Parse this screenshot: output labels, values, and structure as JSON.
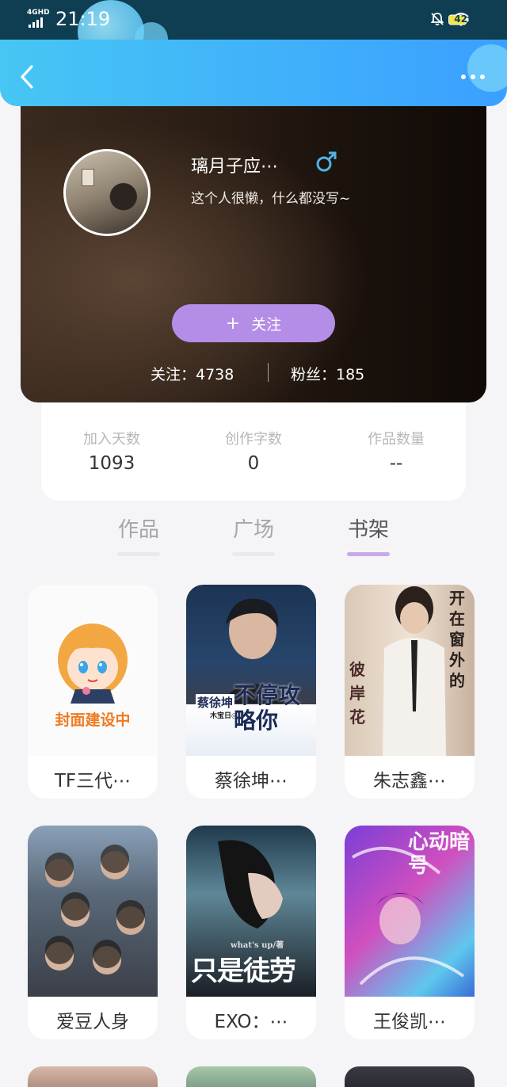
{
  "status_bar": {
    "network": "4GHD",
    "time": "21:19",
    "battery": "42"
  },
  "header": {
    "back_icon": "chevron-left-icon",
    "more_icon": "more-dots-icon"
  },
  "profile": {
    "name": "璃月子应⋯",
    "gender_icon": "male-icon",
    "bio": "这个人很懒，什么都没写~",
    "follow_plus": "+",
    "follow_label": "关注",
    "following": "关注：4738",
    "fans": "粉丝：185"
  },
  "info": {
    "days_label": "加入天数",
    "days_value": "1093",
    "words_label": "创作字数",
    "words_value": "0",
    "works_label": "作品数量",
    "works_value": "--"
  },
  "tabs": [
    {
      "label": "作品"
    },
    {
      "label": "广场"
    },
    {
      "label": "书架"
    }
  ],
  "books": [
    {
      "title": "TF三代⋯",
      "cover_text": "封面建设中"
    },
    {
      "title": "蔡徐坤⋯",
      "cover_text": "不停攻略你",
      "cover_sub": "蔡徐坤",
      "cover_author": "木宝日◎著"
    },
    {
      "title": "朱志鑫⋯",
      "cover_text": "开在窗外的",
      "cover_sub": "彼岸花"
    },
    {
      "title": "爱豆人身"
    },
    {
      "title": "EXO：⋯",
      "cover_text": "只是徒劳",
      "cover_author": "what's up/著"
    },
    {
      "title": "王俊凯⋯",
      "cover_text": "心动暗号"
    }
  ],
  "colors": {
    "header_gradient_start": "#47c6f4",
    "header_gradient_end": "#3aa0ff",
    "follow_button": "#b48ee6",
    "active_tab_underline": "#c9a8ea"
  }
}
